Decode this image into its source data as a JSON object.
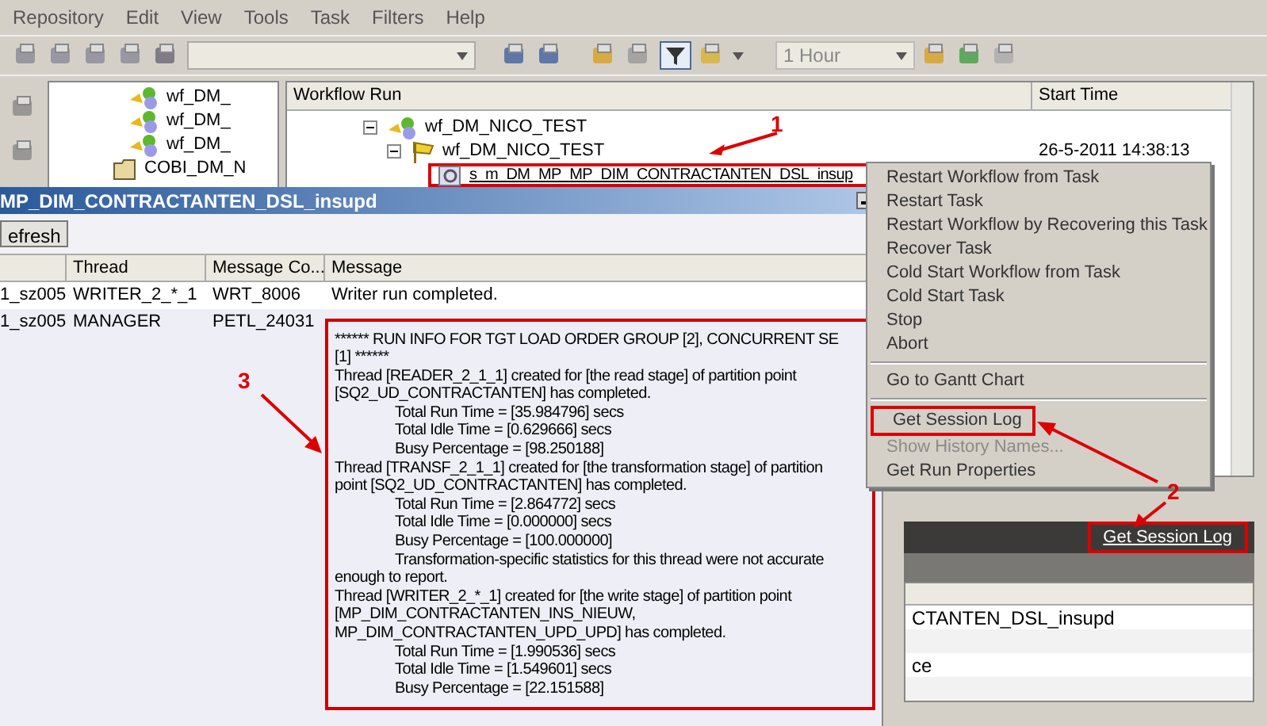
{
  "menu_bar": [
    "Repository",
    "Edit",
    "View",
    "Tools",
    "Task",
    "Filters",
    "Help"
  ],
  "toolbar": {
    "time_filter": "1 Hour"
  },
  "navigator": {
    "items": [
      {
        "label": "wf_DM_",
        "kind": "workflow"
      },
      {
        "label": "wf_DM_",
        "kind": "workflow"
      },
      {
        "label": "wf_DM_",
        "kind": "workflow"
      },
      {
        "label": "COBI_DM_N",
        "kind": "folder"
      }
    ]
  },
  "task_view": {
    "columns": [
      "Workflow Run",
      "Start Time"
    ],
    "tree": [
      {
        "label": "wf_DM_NICO_TEST",
        "kind": "workflow",
        "expanded": true,
        "children": [
          {
            "label": "wf_DM_NICO_TEST",
            "kind": "run",
            "expanded": true,
            "start_time": "26-5-2011 14:38:13",
            "children": [
              {
                "label": "s_m_DM_MP_MP_DIM_CONTRACTANTEN_DSL_insup",
                "kind": "session",
                "selected": true
              }
            ]
          }
        ]
      }
    ]
  },
  "details_panel": {
    "link": "Get Session Log",
    "rows": [
      {
        "text": "CTANTEN_DSL_insupd"
      },
      {},
      {
        "text": "ce"
      },
      {}
    ]
  },
  "session_log": {
    "title": "MP_DIM_CONTRACTANTEN_DSL_insupd",
    "refresh_button": "efresh",
    "columns": [
      "Thread",
      "Message Co...",
      "Message"
    ],
    "rows": [
      {
        "column_1": "1_sz005",
        "thread": "WRITER_2_*_1",
        "code": "WRT_8006",
        "message": [
          {
            "text": "Writer run completed.",
            "kind": "line"
          }
        ]
      },
      {
        "column_1": "1_sz005",
        "thread": "MANAGER",
        "code": "PETL_24031",
        "message": [
          {
            "text": "****** RUN INFO FOR TGT LOAD ORDER GROUP [2], CONCURRENT SE",
            "kind": "line"
          },
          {
            "text": "[1] ******",
            "kind": "line"
          },
          {
            "text": "Thread [READER_2_1_1] created for [the read stage] of partition point",
            "kind": "line"
          },
          {
            "text": "[SQ2_UD_CONTRACTANTEN] has completed.",
            "kind": "line"
          },
          {
            "text": "Total Run Time = [35.984796] secs",
            "kind": "detail"
          },
          {
            "text": "Total Idle Time = [0.629666] secs",
            "kind": "detail"
          },
          {
            "text": "Busy Percentage = [98.250188]",
            "kind": "detail"
          },
          {
            "text": "Thread [TRANSF_2_1_1] created for [the transformation stage] of partition",
            "kind": "line"
          },
          {
            "text": "point [SQ2_UD_CONTRACTANTEN] has completed.",
            "kind": "line"
          },
          {
            "text": "Total Run Time = [2.864772] secs",
            "kind": "detail"
          },
          {
            "text": "Total Idle Time = [0.000000] secs",
            "kind": "detail"
          },
          {
            "text": "Busy Percentage = [100.000000]",
            "kind": "detail"
          },
          {
            "text": "Transformation-specific statistics for this thread were not accurate",
            "kind": "detail"
          },
          {
            "text": "enough to report.",
            "kind": "line"
          },
          {
            "text": "Thread [WRITER_2_*_1] created for [the write stage] of partition point",
            "kind": "line"
          },
          {
            "text": "[MP_DIM_CONTRACTANTEN_INS_NIEUW,",
            "kind": "line"
          },
          {
            "text": "MP_DIM_CONTRACTANTEN_UPD_UPD] has completed.",
            "kind": "line"
          },
          {
            "text": "Total Run Time = [1.990536] secs",
            "kind": "detail"
          },
          {
            "text": "Total Idle Time = [1.549601] secs",
            "kind": "detail"
          },
          {
            "text": "Busy Percentage = [22.151588]",
            "kind": "detail"
          }
        ]
      }
    ]
  },
  "context_menu": {
    "items": [
      {
        "kind": "item",
        "label": "Restart Workflow from Task",
        "disabled": false
      },
      {
        "kind": "item",
        "label": "Restart Task",
        "disabled": false
      },
      {
        "kind": "item",
        "label": "Restart Workflow by Recovering this Task",
        "disabled": false
      },
      {
        "kind": "item",
        "label": "Recover Task",
        "disabled": false
      },
      {
        "kind": "item",
        "label": "Cold Start Workflow from Task",
        "disabled": false
      },
      {
        "kind": "item",
        "label": "Cold Start Task",
        "disabled": false
      },
      {
        "kind": "item",
        "label": "Stop",
        "disabled": false
      },
      {
        "kind": "item",
        "label": "Abort",
        "disabled": false
      },
      {
        "kind": "separator"
      },
      {
        "kind": "item",
        "label": "Go to Gantt Chart",
        "disabled": false
      },
      {
        "kind": "separator"
      },
      {
        "kind": "item",
        "label": "Get Session Log",
        "disabled": false,
        "highlighted": true
      },
      {
        "kind": "item",
        "label": "Show History Names...",
        "disabled": true
      },
      {
        "kind": "item",
        "label": "Get Run Properties",
        "disabled": false
      }
    ]
  },
  "annotations": [
    {
      "label": "1"
    },
    {
      "label": "2"
    },
    {
      "label": "3"
    }
  ]
}
